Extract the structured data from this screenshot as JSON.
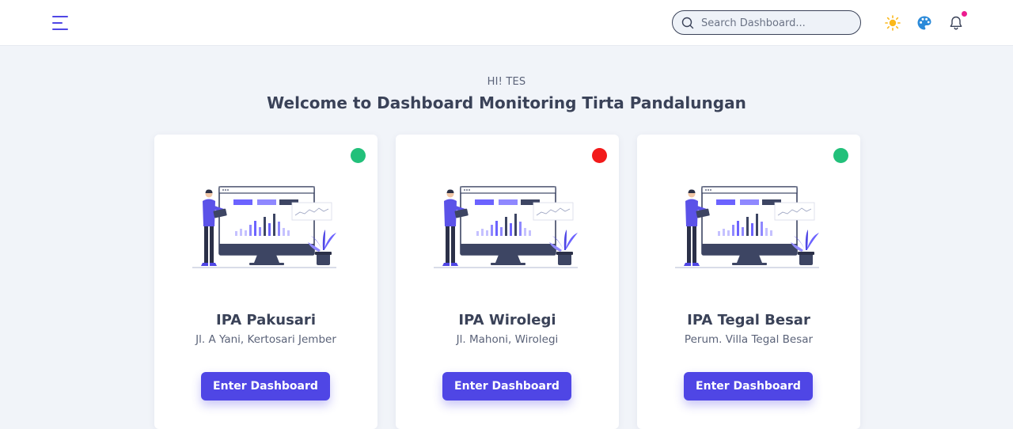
{
  "header": {
    "search": {
      "placeholder": "Search Dashboard..."
    }
  },
  "welcome": {
    "greeting": "HI! TES",
    "title": "Welcome to Dashboard Monitoring Tirta Pandalungan"
  },
  "cards": [
    {
      "title": "IPA Pakusari",
      "address": "Jl. A Yani, Kertosari Jember",
      "status": "online",
      "status_color": "#22c07a",
      "button_label": "Enter Dashboard"
    },
    {
      "title": "IPA Wirolegi",
      "address": "Jl. Mahoni, Wirolegi",
      "status": "offline",
      "status_color": "#f21a1a",
      "button_label": "Enter Dashboard"
    },
    {
      "title": "IPA Tegal Besar",
      "address": "Perum. Villa Tegal Besar",
      "status": "online",
      "status_color": "#22c07a",
      "button_label": "Enter Dashboard"
    }
  ],
  "colors": {
    "accent": "#4f46e5",
    "notification_dot": "#ec1c8f",
    "sun_icon": "#fbb81a",
    "palette_icon": "#2b8ad9"
  },
  "icons": [
    "menu-icon",
    "search-icon",
    "sun-icon",
    "palette-icon",
    "bell-icon"
  ]
}
